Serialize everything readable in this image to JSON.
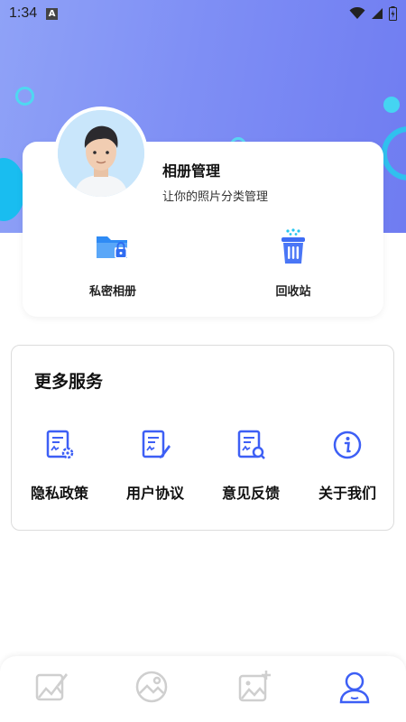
{
  "status_bar": {
    "time": "1:34",
    "notification_icon": "a-icon",
    "icons": [
      "wifi-icon",
      "signal-icon",
      "battery-icon"
    ]
  },
  "album": {
    "title": "相册管理",
    "subtitle": "让你的照片分类管理",
    "avatar_icon": "avatar-icon",
    "quick_actions": [
      {
        "label": "私密相册",
        "icon": "private-folder-icon"
      },
      {
        "label": "回收站",
        "icon": "recycle-bin-icon"
      }
    ]
  },
  "services": {
    "title": "更多服务",
    "items": [
      {
        "label": "隐私政策",
        "icon": "privacy-doc-icon"
      },
      {
        "label": "用户协议",
        "icon": "agreement-doc-icon"
      },
      {
        "label": "意见反馈",
        "icon": "feedback-doc-icon"
      },
      {
        "label": "关于我们",
        "icon": "info-icon"
      }
    ]
  },
  "tabbar": {
    "tabs": [
      {
        "icon": "edit-photo-icon",
        "active": false
      },
      {
        "icon": "album-icon",
        "active": false
      },
      {
        "icon": "add-photo-icon",
        "active": false
      },
      {
        "icon": "profile-icon",
        "active": true
      }
    ]
  },
  "colors": {
    "accent": "#3d5ff5",
    "header_start": "#8fa2f7",
    "header_end": "#6f7cf1",
    "inactive_tab": "#cfcfcf"
  }
}
